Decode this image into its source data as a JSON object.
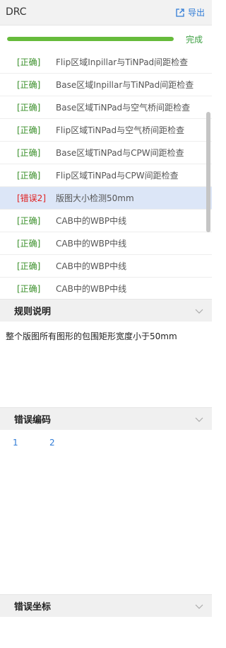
{
  "header": {
    "title": "DRC",
    "export_label": "导出"
  },
  "progress": {
    "value_percent": 100,
    "status": "完成"
  },
  "rules": [
    {
      "status": "[正确]",
      "name": "Flip区域Inpillar与TiNPad间距检查",
      "state": "ok"
    },
    {
      "status": "[正确]",
      "name": "Base区域Inpillar与TiNPad间距检查",
      "state": "ok"
    },
    {
      "status": "[正确]",
      "name": "Base区域TiNPad与空气桥间距检查",
      "state": "ok"
    },
    {
      "status": "[正确]",
      "name": "Flip区域TiNPad与空气桥间距检查",
      "state": "ok"
    },
    {
      "status": "[正确]",
      "name": "Base区域TiNPad与CPW间距检查",
      "state": "ok"
    },
    {
      "status": "[正确]",
      "name": "Flip区域TiNPad与CPW间距检查",
      "state": "ok"
    },
    {
      "status": "[错误2]",
      "name": "版图大小检测50mm",
      "state": "err"
    },
    {
      "status": "[正确]",
      "name": "CAB中的WBP中线",
      "state": "ok"
    },
    {
      "status": "[正确]",
      "name": "CAB中的WBP中线",
      "state": "ok"
    },
    {
      "status": "[正确]",
      "name": "CAB中的WBP中线",
      "state": "ok"
    },
    {
      "status": "[正确]",
      "name": "CAB中的WBP中线",
      "state": "ok"
    }
  ],
  "rule_description": {
    "title": "规则说明",
    "text": "整个版图所有图形的包围矩形宽度小于50mm"
  },
  "error_codes": {
    "title": "错误编码",
    "codes": [
      "1",
      "2"
    ]
  },
  "error_coords": {
    "title": "错误坐标"
  },
  "colors": {
    "ok": "#3a8f2a",
    "error": "#e02020",
    "accent": "#2f7bd6",
    "progress": "#66bb3b",
    "selected": "#dce6f7"
  }
}
